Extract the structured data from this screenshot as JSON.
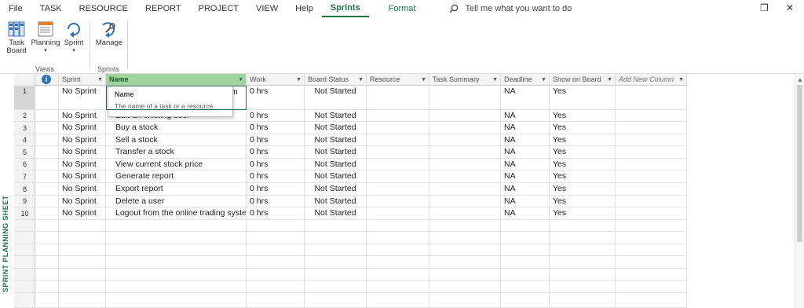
{
  "menu": {
    "items": [
      "File",
      "TASK",
      "RESOURCE",
      "REPORT",
      "PROJECT",
      "VIEW",
      "Help",
      "Sprints",
      "Format"
    ],
    "active": "Sprints",
    "tell_me": "Tell me what you want to do"
  },
  "ribbon": {
    "task_board": "Task",
    "task_board_2": "Board",
    "planning": "Planning",
    "sprint": "Sprint",
    "manage": "Manage",
    "group_views": "Views",
    "group_sprints": "Sprints"
  },
  "sheet": {
    "side_label": "SPRINT PLANNING SHEET",
    "columns": [
      "Sprint",
      "Name",
      "Work",
      "Board Status",
      "Resource",
      "Task Summary",
      "Deadline",
      "Show on Board",
      "Add New Column"
    ],
    "tooltip_title": "Name",
    "tooltip_body": "The name of a task or a resource.",
    "row1_name_tail": "m",
    "rows": [
      {
        "num": "1",
        "sprint": "No Sprint",
        "name": "",
        "work": "0 hrs",
        "status": "Not Started",
        "deadline": "NA",
        "show": "Yes"
      },
      {
        "num": "2",
        "sprint": "No Sprint",
        "name": "Edit an existing user",
        "work": "0 hrs",
        "status": "Not Started",
        "deadline": "NA",
        "show": "Yes"
      },
      {
        "num": "3",
        "sprint": "No Sprint",
        "name": "Buy a stock",
        "work": "0 hrs",
        "status": "Not Started",
        "deadline": "NA",
        "show": "Yes"
      },
      {
        "num": "4",
        "sprint": "No Sprint",
        "name": "Sell a stock",
        "work": "0 hrs",
        "status": "Not Started",
        "deadline": "NA",
        "show": "Yes"
      },
      {
        "num": "5",
        "sprint": "No Sprint",
        "name": "Transfer a stock",
        "work": "0 hrs",
        "status": "Not Started",
        "deadline": "NA",
        "show": "Yes"
      },
      {
        "num": "6",
        "sprint": "No Sprint",
        "name": "View current stock price",
        "work": "0 hrs",
        "status": "Not Started",
        "deadline": "NA",
        "show": "Yes"
      },
      {
        "num": "7",
        "sprint": "No Sprint",
        "name": "Generate report",
        "work": "0 hrs",
        "status": "Not Started",
        "deadline": "NA",
        "show": "Yes"
      },
      {
        "num": "8",
        "sprint": "No Sprint",
        "name": "Export report",
        "work": "0 hrs",
        "status": "Not Started",
        "deadline": "NA",
        "show": "Yes"
      },
      {
        "num": "9",
        "sprint": "No Sprint",
        "name": "Delete a user",
        "work": "0 hrs",
        "status": "Not Started",
        "deadline": "NA",
        "show": "Yes"
      },
      {
        "num": "10",
        "sprint": "No Sprint",
        "name": "Logout from the online trading syste",
        "work": "0 hrs",
        "status": "Not Started",
        "deadline": "NA",
        "show": "Yes"
      }
    ]
  },
  "colors": {
    "accent": "#217346",
    "selected_header": "#9fd49f",
    "info": "#2f6fb5"
  }
}
